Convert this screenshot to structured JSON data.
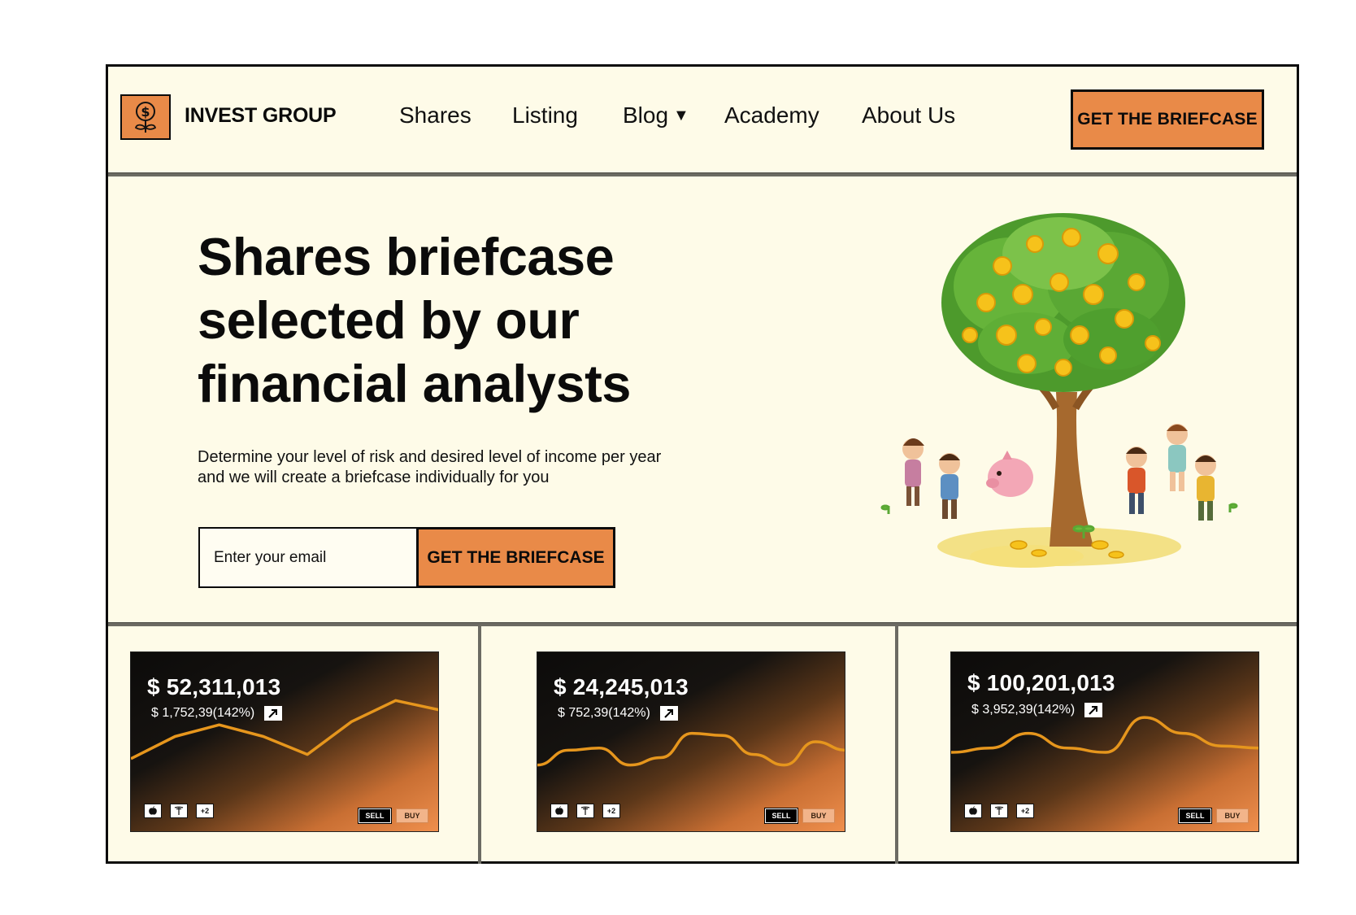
{
  "header": {
    "brand": "INVEST GROUP",
    "logo_icon": "dollar-plant-icon",
    "nav": [
      {
        "label": "Shares"
      },
      {
        "label": "Listing"
      },
      {
        "label": "Blog",
        "has_dropdown": true
      },
      {
        "label": "Academy"
      },
      {
        "label": "About Us"
      }
    ],
    "cta_label": "GET THE BRIEFCASE"
  },
  "hero": {
    "title_lines": [
      "Shares briefcase",
      "selected by our",
      "financial analysts"
    ],
    "subtitle_lines": [
      "Determine your level of risk and desired level of income per year",
      "and we will create a briefcase individually for you"
    ],
    "email_placeholder": "Enter your email",
    "cta_label": "GET THE BRIEFCASE",
    "illustration": "money-tree-with-children-illustration"
  },
  "cards": [
    {
      "value": "$ 52,311,013",
      "change": "$ 1,752,39(142%)",
      "chips": [
        "apple-icon",
        "tesla-icon",
        "+2"
      ],
      "sell_label": "SELL",
      "buy_label": "BUY",
      "line": [
        0.34,
        0.55,
        0.66,
        0.55,
        0.38,
        0.69,
        0.89,
        0.8
      ]
    },
    {
      "value": "$ 24,245,013",
      "change": "$ 752,39(142%)",
      "chips": [
        "apple-icon",
        "tesla-icon",
        "+2"
      ],
      "sell_label": "SELL",
      "buy_label": "BUY",
      "line": [
        0.28,
        0.42,
        0.44,
        0.28,
        0.35,
        0.58,
        0.56,
        0.38,
        0.28,
        0.5,
        0.42
      ]
    },
    {
      "value": "$ 100,201,013",
      "change": "$ 3,952,39(142%)",
      "chips": [
        "apple-icon",
        "tesla-icon",
        "+2"
      ],
      "sell_label": "SELL",
      "buy_label": "BUY",
      "line": [
        0.4,
        0.44,
        0.58,
        0.44,
        0.4,
        0.73,
        0.58,
        0.46,
        0.44
      ]
    }
  ],
  "colors": {
    "accent": "#e98a48",
    "background": "#fefbe8",
    "line": "#e6961d"
  }
}
